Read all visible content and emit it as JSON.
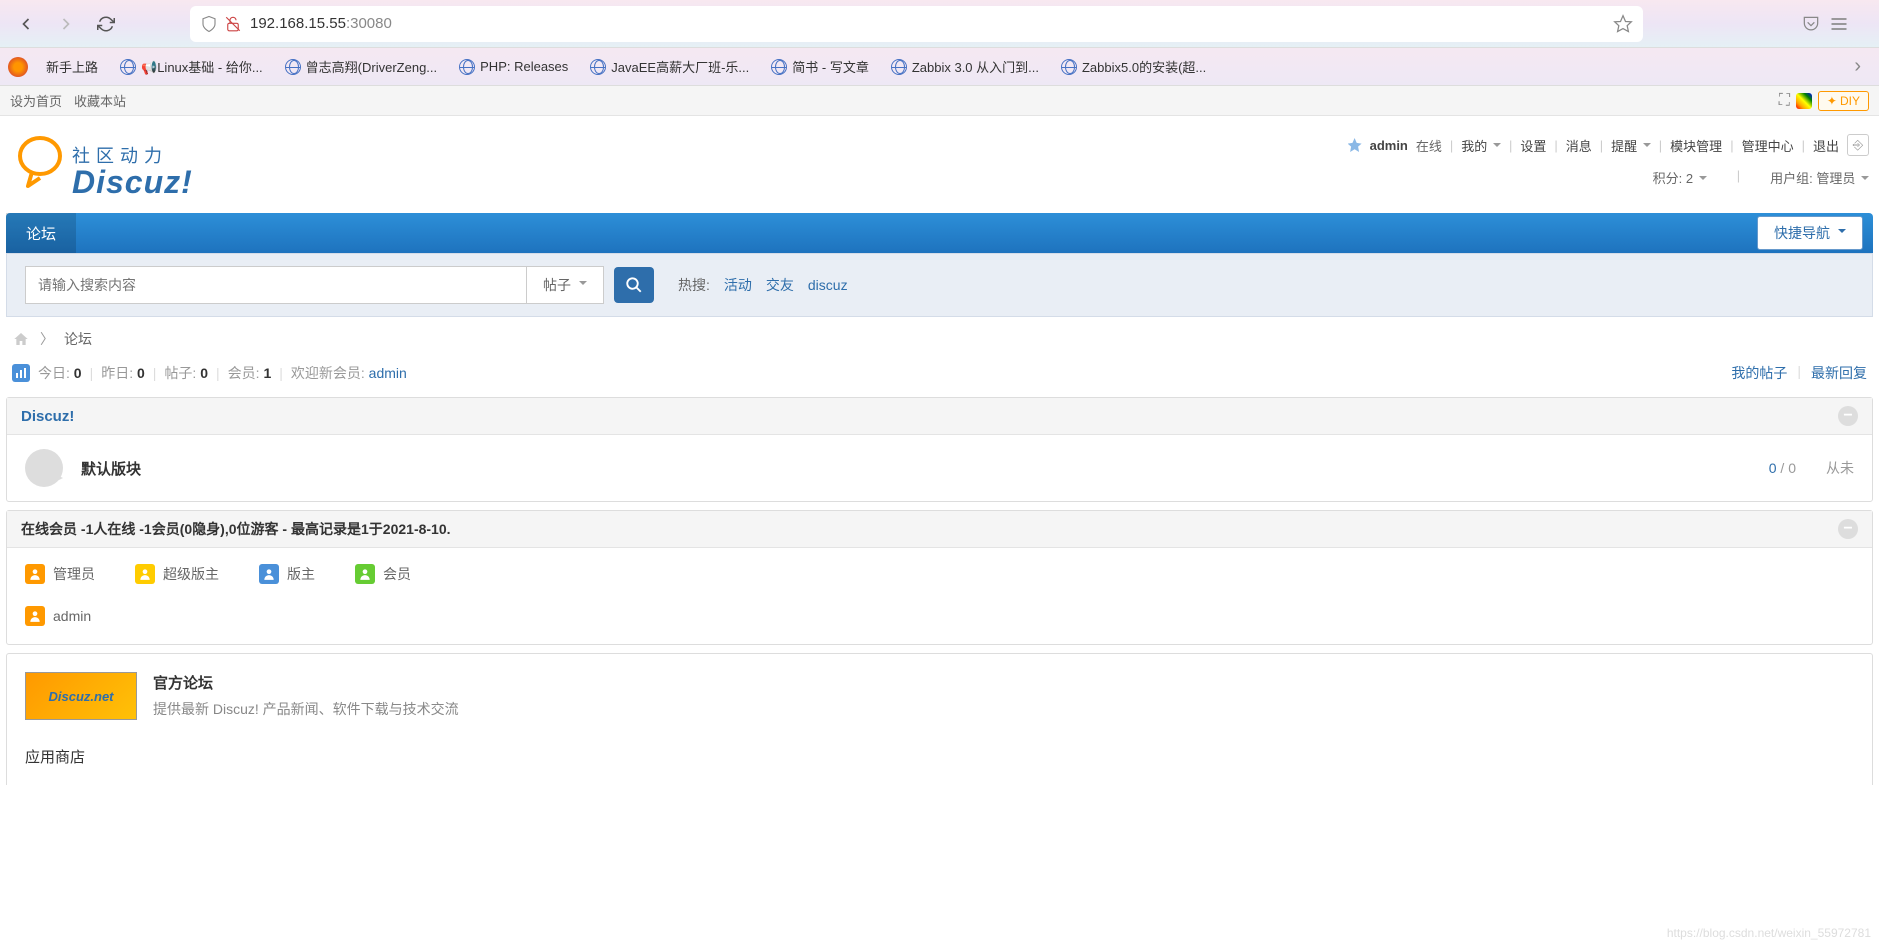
{
  "browser": {
    "url_host": "192.168.15.55",
    "url_port": ":30080"
  },
  "bookmarks": [
    {
      "label": "新手上路",
      "icon": "firefox"
    },
    {
      "label": "📢Linux基础 - 给你...",
      "icon": "globe"
    },
    {
      "label": "曾志高翔(DriverZeng...",
      "icon": "globe"
    },
    {
      "label": "PHP: Releases",
      "icon": "globe"
    },
    {
      "label": "JavaEE高薪大厂班-乐...",
      "icon": "globe"
    },
    {
      "label": "简书 - 写文章",
      "icon": "globe"
    },
    {
      "label": "Zabbix 3.0 从入门到...",
      "icon": "globe"
    },
    {
      "label": "Zabbix5.0的安装(超...",
      "icon": "globe"
    }
  ],
  "topbar": {
    "set_home": "设为首页",
    "favorite": "收藏本站",
    "diy": "DIY"
  },
  "logo": {
    "cn": "社区动力",
    "en": "Discuz!"
  },
  "user_menu": {
    "username": "admin",
    "online": "在线",
    "mine": "我的",
    "settings": "设置",
    "messages": "消息",
    "reminders": "提醒",
    "modules": "模块管理",
    "admin_center": "管理中心",
    "logout": "退出"
  },
  "user_info": {
    "points_label": "积分:",
    "points_value": "2",
    "group_label": "用户组:",
    "group_value": "管理员"
  },
  "nav": {
    "forum_tab": "论坛",
    "quick_nav": "快捷导航"
  },
  "search": {
    "placeholder": "请输入搜索内容",
    "type": "帖子",
    "hot_label": "热搜:",
    "hot_items": [
      "活动",
      "交友",
      "discuz"
    ]
  },
  "breadcrumb": {
    "forum": "论坛"
  },
  "stats": {
    "today": "今日: ",
    "today_val": "0",
    "yesterday": "昨日: ",
    "yesterday_val": "0",
    "posts": "帖子: ",
    "posts_val": "0",
    "members": "会员: ",
    "members_val": "1",
    "welcome": "欢迎新会员: ",
    "welcome_name": "admin",
    "my_posts": "我的帖子",
    "latest_reply": "最新回复"
  },
  "category": {
    "name": "Discuz!"
  },
  "forum": {
    "name": "默认版块",
    "threads": "0",
    "sep": " / ",
    "posts": "0",
    "last": "从未"
  },
  "online": {
    "title_parts": {
      "p1": "在线会员 - ",
      "v1": "1",
      "p2": " 人在线 - ",
      "v2": "1",
      "p3": " 会员(",
      "v3": "0",
      "p4": " 隐身), ",
      "v4": "0",
      "p5": " 位游客 - 最高记录是 ",
      "v5": "1",
      "p6": " 于 ",
      "date": "2021-8-10",
      "end": "."
    },
    "legend": {
      "admin": "管理员",
      "super_mod": "超级版主",
      "moderator": "版主",
      "member": "会员"
    },
    "user": "admin"
  },
  "official": {
    "title": "官方论坛",
    "desc": "提供最新 Discuz! 产品新闻、软件下载与技术交流",
    "banner": "Discuz.net"
  },
  "app_store": {
    "title": "应用商店"
  },
  "watermark": "https://blog.csdn.net/weixin_55972781"
}
